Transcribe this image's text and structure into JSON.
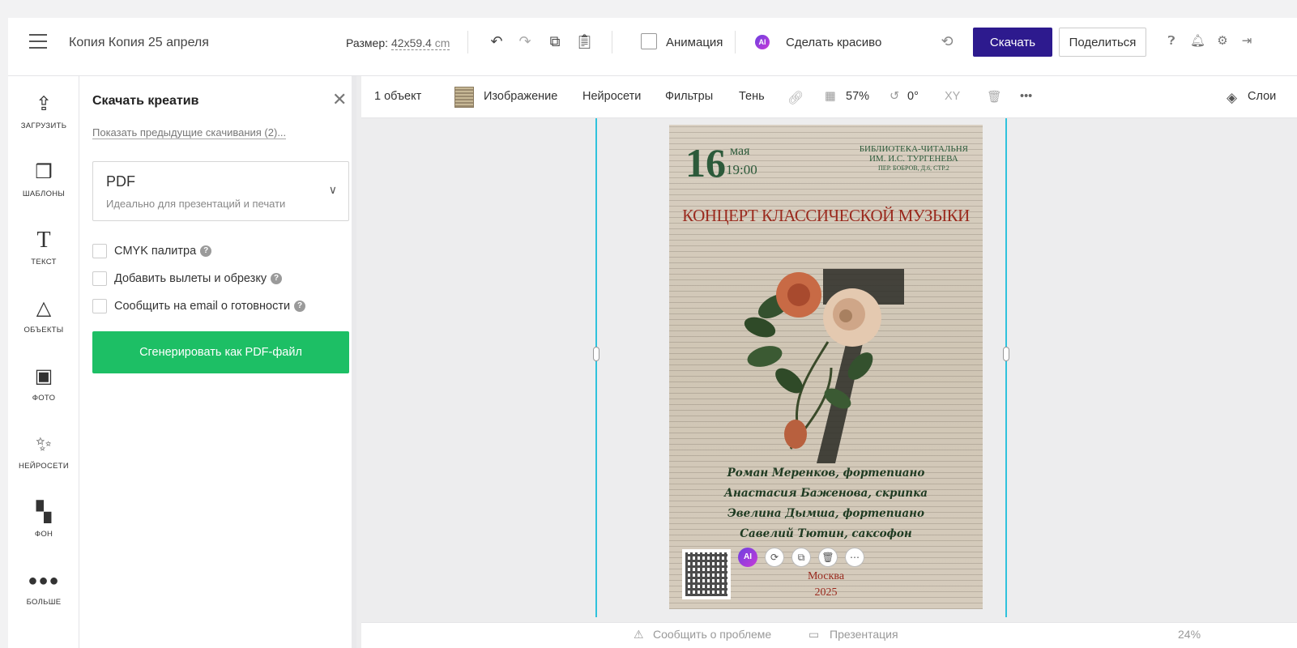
{
  "header": {
    "doc_title": "Копия Копия 25 апреля",
    "size_label": "Размер:",
    "size_value": "42x59.4",
    "size_unit": "cm",
    "animation_label": "Анимация",
    "ai_badge": "AI",
    "make_pretty_label": "Сделать красиво",
    "download_label": "Скачать",
    "share_label": "Поделиться",
    "brand_color": "#2d1a8e"
  },
  "sidebar": {
    "items": [
      {
        "label": "ЗАГРУЗИТЬ",
        "icon": "upload-icon"
      },
      {
        "label": "ШАБЛОНЫ",
        "icon": "templates-icon"
      },
      {
        "label": "ТЕКСТ",
        "icon": "text-icon"
      },
      {
        "label": "ОБЪЕКТЫ",
        "icon": "objects-icon"
      },
      {
        "label": "ФОТО",
        "icon": "photo-icon"
      },
      {
        "label": "НЕЙРОСЕТИ",
        "icon": "magic-wand-icon"
      },
      {
        "label": "ФОН",
        "icon": "background-icon"
      },
      {
        "label": "БОЛЬШЕ",
        "icon": "more-icon"
      }
    ]
  },
  "panel": {
    "title": "Скачать креатив",
    "prev_downloads": "Показать предыдущие скачивания (2)...",
    "format": {
      "value": "PDF",
      "description": "Идеально для презентаций и печати"
    },
    "options": [
      {
        "label": "CMYK палитра",
        "checked": false
      },
      {
        "label": "Добавить вылеты и обрезку",
        "checked": false
      },
      {
        "label": "Сообщить на email о готовности",
        "checked": false
      }
    ],
    "generate_label": "Сгенерировать как PDF-файл",
    "generate_color": "#1dbf65"
  },
  "object_toolbar": {
    "count": "1 объект",
    "image": "Изображение",
    "neural": "Нейросети",
    "filters": "Фильтры",
    "shadow": "Тень",
    "opacity": "57%",
    "rotation": "0°",
    "xy": "XY",
    "layers": "Слои"
  },
  "poster": {
    "day": "16",
    "month": "мая",
    "time": "19:00",
    "venue_line1": "БИБЛИОТЕКА-ЧИТАЛЬНЯ",
    "venue_line2": "ИМ. И.С. ТУРГЕНЕВА",
    "venue_line3": "ПЕР. БОБРОВ, Д.6, СТР.2",
    "title": "КОНЦЕРТ КЛАССИЧЕСКОЙ МУЗЫКИ",
    "performers": [
      "Роман Меренков, фортепиано",
      "Анастасия Баженова, скрипка",
      "Эвелина Дымша, фортепиано",
      "Савелий Тютин, саксофон"
    ],
    "city": "Москва",
    "year": "2025"
  },
  "floating_tools": {
    "ai": "AI"
  },
  "bottom": {
    "report": "Сообщить о проблеме",
    "presentation": "Презентация",
    "zoom": "24%"
  }
}
